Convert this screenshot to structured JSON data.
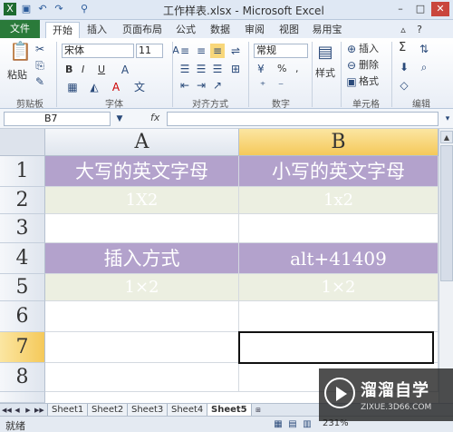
{
  "window": {
    "title": "工作样表.xlsx - Microsoft Excel"
  },
  "ribbon": {
    "tabs": [
      {
        "label": "文件"
      },
      {
        "label": "开始"
      },
      {
        "label": "插入"
      },
      {
        "label": "页面布局"
      },
      {
        "label": "公式"
      },
      {
        "label": "数据"
      },
      {
        "label": "审阅"
      },
      {
        "label": "视图"
      },
      {
        "label": "易用宝"
      }
    ],
    "clipboard": {
      "paste_label": "粘贴",
      "group_label": "剪贴板"
    },
    "font": {
      "family": "宋体",
      "size": "11",
      "group_label": "字体",
      "bold": "B",
      "italic": "I",
      "underline": "U"
    },
    "alignment": {
      "group_label": "对齐方式"
    },
    "number": {
      "format": "常规",
      "percent": "%",
      "comma": ",",
      "group_label": "数字"
    },
    "styles": {
      "label": "样式"
    },
    "cells": {
      "insert": "插入",
      "delete": "删除",
      "format": "格式",
      "group_label": "单元格"
    },
    "editing": {
      "sum": "Σ",
      "group_label": "编辑"
    }
  },
  "formula_bar": {
    "name_box": "B7",
    "fx": "fx",
    "content": ""
  },
  "grid": {
    "columns": [
      "A",
      "B"
    ],
    "rows": [
      "1",
      "2",
      "3",
      "4",
      "5",
      "6",
      "7",
      "8"
    ],
    "cells": {
      "A1": "大写的英文字母",
      "B1": "小写的英文字母",
      "A2": "1X2",
      "B2": "1x2",
      "A4": "插入方式",
      "B4": "alt+41409",
      "A5": "1×2",
      "B5": "1×2"
    },
    "selected_cell": "B7",
    "colors": {
      "purple": "#b3a2cc",
      "green": "#ecefe1",
      "header_active": "#f5c95a"
    }
  },
  "sheets": {
    "tabs": [
      "Sheet1",
      "Sheet2",
      "Sheet3",
      "Sheet4",
      "Sheet5"
    ],
    "active": "Sheet5"
  },
  "status": {
    "ready": "就绪",
    "zoom": "231%"
  },
  "watermark": {
    "text": "溜溜自学",
    "url": "ZIXUE.3D66.COM"
  }
}
